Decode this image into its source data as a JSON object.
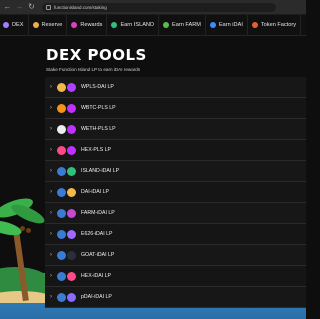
{
  "browser": {
    "url": "functionisland.com/staking",
    "back_icon": "arrow-left",
    "forward_icon": "arrow-right",
    "reload_icon": "reload"
  },
  "nav": {
    "items": [
      {
        "label": "DEX",
        "icon": "swap-icon",
        "color": "#a97bff"
      },
      {
        "label": "Reserve",
        "icon": "reserve-icon",
        "color": "#f0b040"
      },
      {
        "label": "Rewards",
        "icon": "rewards-icon",
        "color": "#e040c0"
      },
      {
        "label": "Earn ISLAND",
        "icon": "earn-island-icon",
        "color": "#2ec27e"
      },
      {
        "label": "Earn FARM",
        "icon": "earn-farm-icon",
        "color": "#56c04a"
      },
      {
        "label": "Earn iDAI",
        "icon": "earn-idai-icon",
        "color": "#3a8cff"
      },
      {
        "label": "Token Factory",
        "icon": "factory-icon",
        "color": "#e06030"
      }
    ]
  },
  "page": {
    "title": "DEX POOLS",
    "subtitle": "Stake Function Island LP to earn iDAI rewards"
  },
  "pools": [
    {
      "name": "WPLS-DAI LP",
      "token_a": "#f4b84a",
      "token_b": "#b040ff"
    },
    {
      "name": "WBTC-PLS LP",
      "token_a": "#f7931a",
      "token_b": "#c030ff"
    },
    {
      "name": "WETH-PLS LP",
      "token_a": "#eeeeee",
      "token_b": "#c030ff"
    },
    {
      "name": "HEX-PLS LP",
      "token_a": "#ff4a8a",
      "token_b": "#c030ff"
    },
    {
      "name": "ISLAND-iDAI LP",
      "token_a": "#3a7bd5",
      "token_b": "#2fc07a"
    },
    {
      "name": "DAI-iDAI LP",
      "token_a": "#3a7bd5",
      "token_b": "#f4b84a"
    },
    {
      "name": "FARM-iDAI LP",
      "token_a": "#3a7bd5",
      "token_b": "#c44ad0"
    },
    {
      "name": "E626-iDAI LP",
      "token_a": "#3a7bd5",
      "token_b": "#9b6bff"
    },
    {
      "name": "GOAT-iDAI LP",
      "token_a": "#3a7bd5",
      "token_b": "#2b2f3a"
    },
    {
      "name": "HEX-iDAI LP",
      "token_a": "#3a7bd5",
      "token_b": "#ff4a8a"
    },
    {
      "name": "pDAI-iDAI LP",
      "token_a": "#3a7bd5",
      "token_b": "#8a6bff"
    }
  ]
}
